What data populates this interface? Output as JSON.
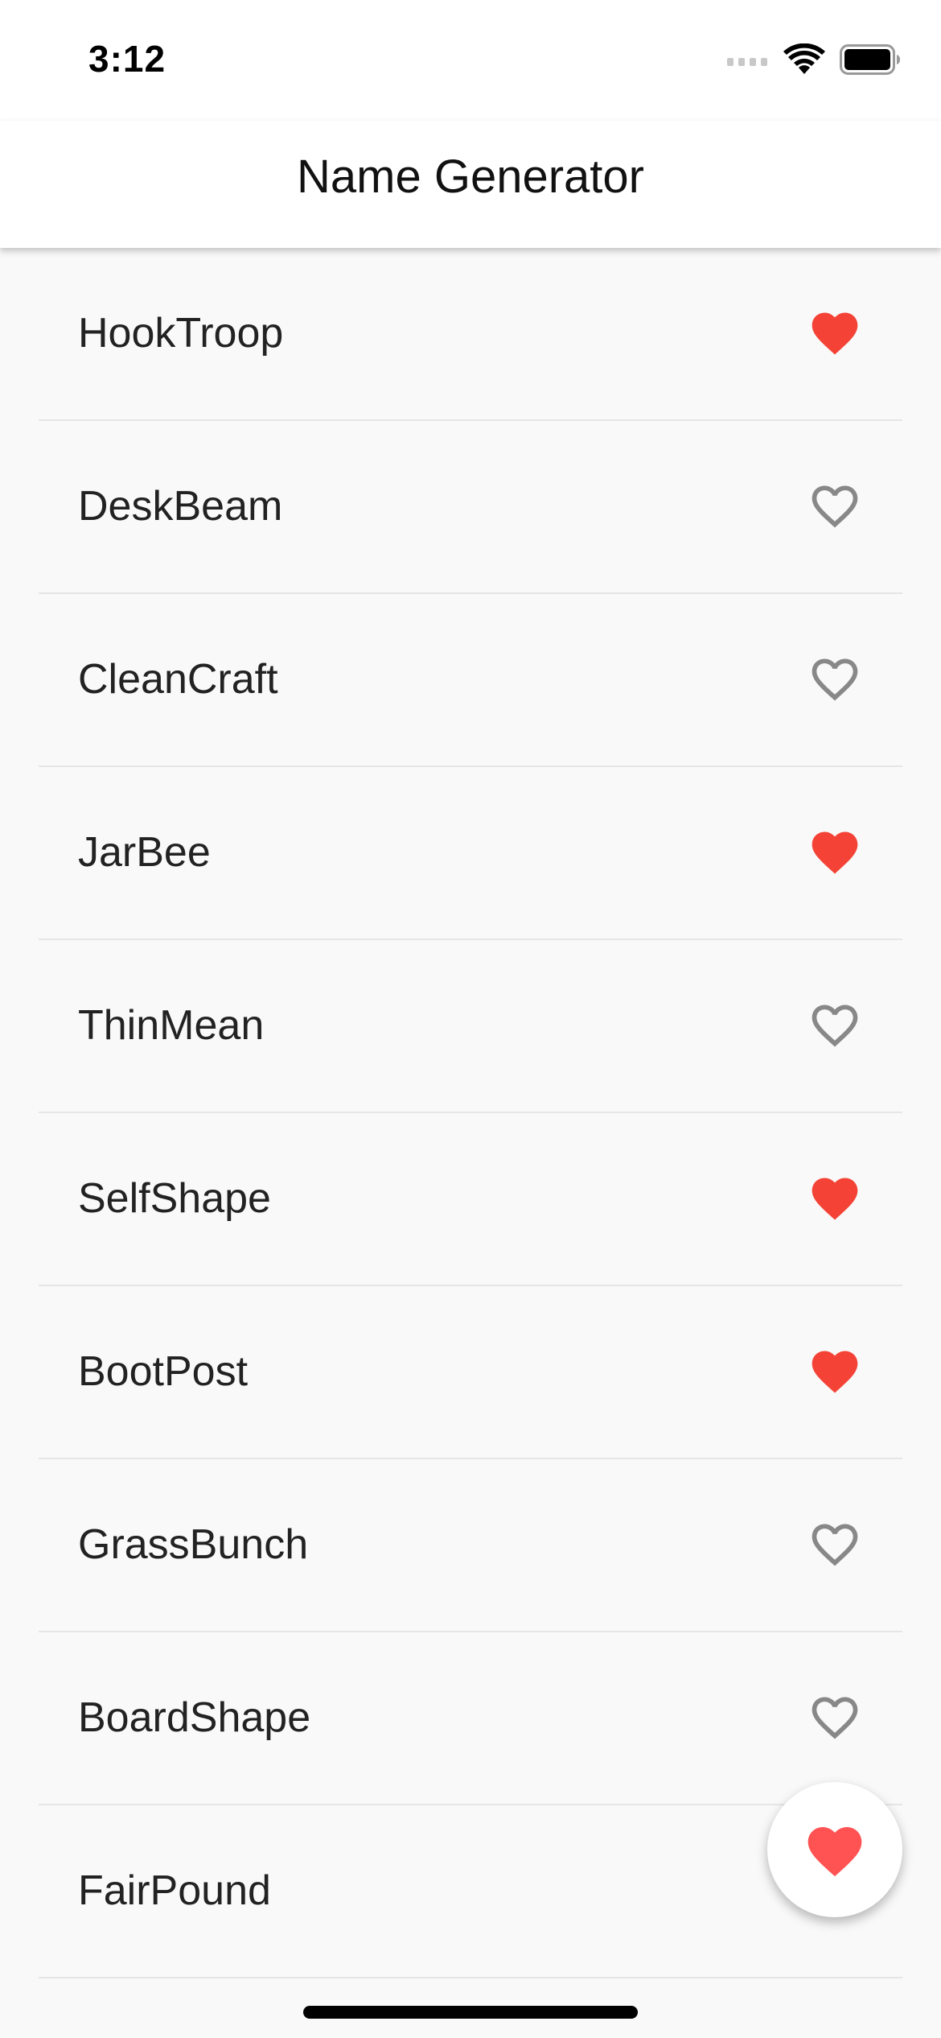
{
  "status_bar": {
    "time": "3:12",
    "icons": [
      "cellular-signal-icon",
      "wifi-icon",
      "battery-icon"
    ]
  },
  "app_bar": {
    "title": "Name Generator"
  },
  "colors": {
    "favorite": "#f44336",
    "unfavorite": "#888888",
    "fab_heart": "#ff5252"
  },
  "names": [
    {
      "label": "HookTroop",
      "favorited": true
    },
    {
      "label": "DeskBeam",
      "favorited": false
    },
    {
      "label": "CleanCraft",
      "favorited": false
    },
    {
      "label": "JarBee",
      "favorited": true
    },
    {
      "label": "ThinMean",
      "favorited": false
    },
    {
      "label": "SelfShape",
      "favorited": true
    },
    {
      "label": "BootPost",
      "favorited": true
    },
    {
      "label": "GrassBunch",
      "favorited": false
    },
    {
      "label": "BoardShape",
      "favorited": false
    },
    {
      "label": "FairPound",
      "favorited": false
    }
  ],
  "fab": {
    "icon": "heart-icon"
  }
}
